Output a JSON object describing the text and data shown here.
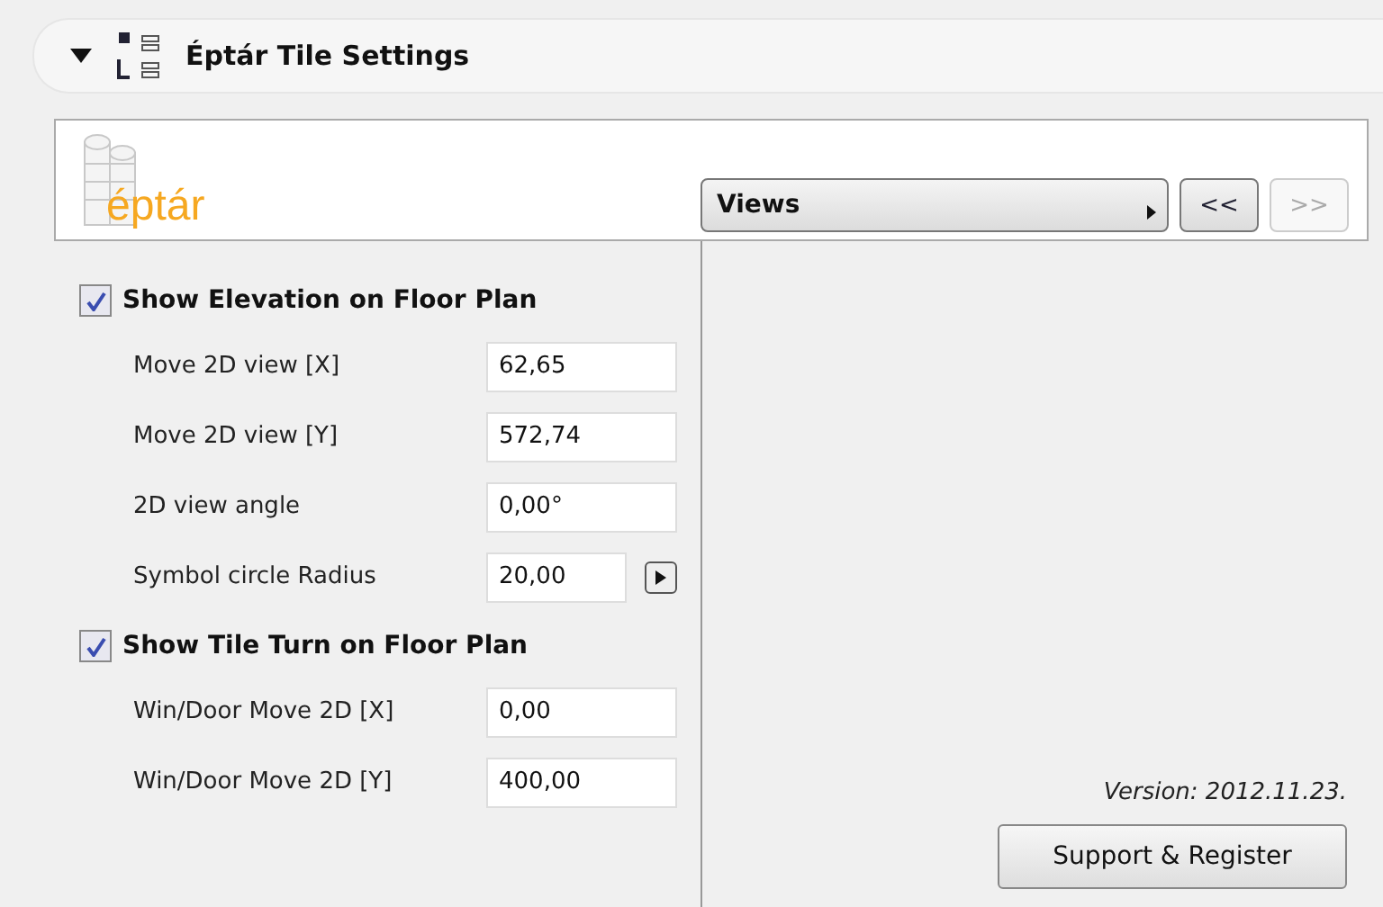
{
  "header": {
    "title": "Éptár Tile Settings",
    "expanded": true
  },
  "logo": {
    "text": "éptár"
  },
  "views_menu": {
    "label": "Views"
  },
  "nav_buttons": [
    {
      "label": "<<",
      "disabled": false
    },
    {
      "label": ">>",
      "disabled": true
    }
  ],
  "sections": [
    {
      "label": "Show Elevation on Floor Plan",
      "checked": true,
      "fields": [
        {
          "label": "Move 2D view [X]",
          "value": "62,65",
          "kind": "plain"
        },
        {
          "label": "Move 2D view [Y]",
          "value": "572,74",
          "kind": "plain"
        },
        {
          "label": "2D view angle",
          "value": "0,00°",
          "kind": "plain"
        },
        {
          "label": "Symbol circle Radius",
          "value": "20,00",
          "kind": "arrow"
        }
      ]
    },
    {
      "label": "Show Tile Turn on Floor Plan",
      "checked": true,
      "fields": [
        {
          "label": "Win/Door Move 2D [X]",
          "value": "0,00",
          "kind": "plain"
        },
        {
          "label": "Win/Door Move 2D [Y]",
          "value": "400,00",
          "kind": "plain"
        }
      ]
    }
  ],
  "version": "Version: 2012.11.23.",
  "support_button": "Support & Register"
}
